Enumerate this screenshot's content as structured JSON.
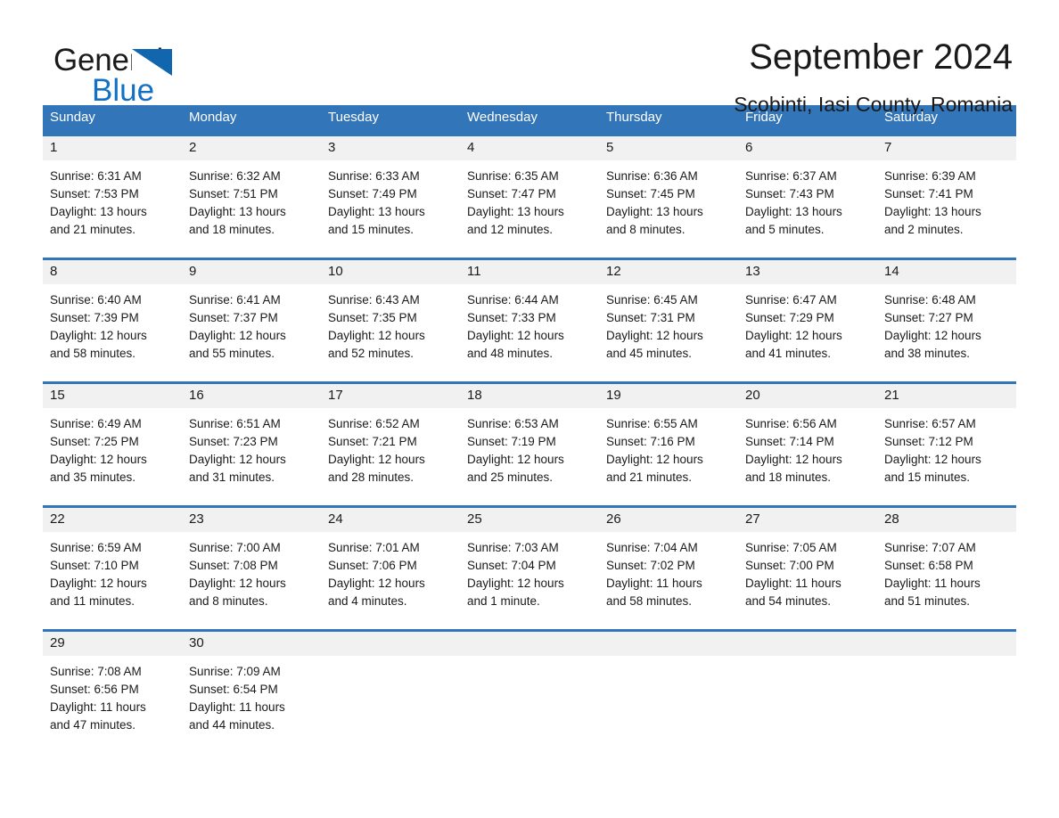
{
  "brand": {
    "name_part1": "General",
    "name_part2": "Blue",
    "triangle_icon": "triangle-icon",
    "accent_color": "#1271c4"
  },
  "header": {
    "title": "September 2024",
    "subtitle": "Scobinti, Iasi County, Romania"
  },
  "colors": {
    "header_blue": "#3275b8",
    "band_gray": "#f1f1f1",
    "text": "#1a1a1a"
  },
  "calendar": {
    "weekday_headers": [
      "Sunday",
      "Monday",
      "Tuesday",
      "Wednesday",
      "Thursday",
      "Friday",
      "Saturday"
    ],
    "weeks": [
      [
        {
          "day": "1",
          "sunrise": "Sunrise: 6:31 AM",
          "sunset": "Sunset: 7:53 PM",
          "daylight1": "Daylight: 13 hours",
          "daylight2": "and 21 minutes."
        },
        {
          "day": "2",
          "sunrise": "Sunrise: 6:32 AM",
          "sunset": "Sunset: 7:51 PM",
          "daylight1": "Daylight: 13 hours",
          "daylight2": "and 18 minutes."
        },
        {
          "day": "3",
          "sunrise": "Sunrise: 6:33 AM",
          "sunset": "Sunset: 7:49 PM",
          "daylight1": "Daylight: 13 hours",
          "daylight2": "and 15 minutes."
        },
        {
          "day": "4",
          "sunrise": "Sunrise: 6:35 AM",
          "sunset": "Sunset: 7:47 PM",
          "daylight1": "Daylight: 13 hours",
          "daylight2": "and 12 minutes."
        },
        {
          "day": "5",
          "sunrise": "Sunrise: 6:36 AM",
          "sunset": "Sunset: 7:45 PM",
          "daylight1": "Daylight: 13 hours",
          "daylight2": "and 8 minutes."
        },
        {
          "day": "6",
          "sunrise": "Sunrise: 6:37 AM",
          "sunset": "Sunset: 7:43 PM",
          "daylight1": "Daylight: 13 hours",
          "daylight2": "and 5 minutes."
        },
        {
          "day": "7",
          "sunrise": "Sunrise: 6:39 AM",
          "sunset": "Sunset: 7:41 PM",
          "daylight1": "Daylight: 13 hours",
          "daylight2": "and 2 minutes."
        }
      ],
      [
        {
          "day": "8",
          "sunrise": "Sunrise: 6:40 AM",
          "sunset": "Sunset: 7:39 PM",
          "daylight1": "Daylight: 12 hours",
          "daylight2": "and 58 minutes."
        },
        {
          "day": "9",
          "sunrise": "Sunrise: 6:41 AM",
          "sunset": "Sunset: 7:37 PM",
          "daylight1": "Daylight: 12 hours",
          "daylight2": "and 55 minutes."
        },
        {
          "day": "10",
          "sunrise": "Sunrise: 6:43 AM",
          "sunset": "Sunset: 7:35 PM",
          "daylight1": "Daylight: 12 hours",
          "daylight2": "and 52 minutes."
        },
        {
          "day": "11",
          "sunrise": "Sunrise: 6:44 AM",
          "sunset": "Sunset: 7:33 PM",
          "daylight1": "Daylight: 12 hours",
          "daylight2": "and 48 minutes."
        },
        {
          "day": "12",
          "sunrise": "Sunrise: 6:45 AM",
          "sunset": "Sunset: 7:31 PM",
          "daylight1": "Daylight: 12 hours",
          "daylight2": "and 45 minutes."
        },
        {
          "day": "13",
          "sunrise": "Sunrise: 6:47 AM",
          "sunset": "Sunset: 7:29 PM",
          "daylight1": "Daylight: 12 hours",
          "daylight2": "and 41 minutes."
        },
        {
          "day": "14",
          "sunrise": "Sunrise: 6:48 AM",
          "sunset": "Sunset: 7:27 PM",
          "daylight1": "Daylight: 12 hours",
          "daylight2": "and 38 minutes."
        }
      ],
      [
        {
          "day": "15",
          "sunrise": "Sunrise: 6:49 AM",
          "sunset": "Sunset: 7:25 PM",
          "daylight1": "Daylight: 12 hours",
          "daylight2": "and 35 minutes."
        },
        {
          "day": "16",
          "sunrise": "Sunrise: 6:51 AM",
          "sunset": "Sunset: 7:23 PM",
          "daylight1": "Daylight: 12 hours",
          "daylight2": "and 31 minutes."
        },
        {
          "day": "17",
          "sunrise": "Sunrise: 6:52 AM",
          "sunset": "Sunset: 7:21 PM",
          "daylight1": "Daylight: 12 hours",
          "daylight2": "and 28 minutes."
        },
        {
          "day": "18",
          "sunrise": "Sunrise: 6:53 AM",
          "sunset": "Sunset: 7:19 PM",
          "daylight1": "Daylight: 12 hours",
          "daylight2": "and 25 minutes."
        },
        {
          "day": "19",
          "sunrise": "Sunrise: 6:55 AM",
          "sunset": "Sunset: 7:16 PM",
          "daylight1": "Daylight: 12 hours",
          "daylight2": "and 21 minutes."
        },
        {
          "day": "20",
          "sunrise": "Sunrise: 6:56 AM",
          "sunset": "Sunset: 7:14 PM",
          "daylight1": "Daylight: 12 hours",
          "daylight2": "and 18 minutes."
        },
        {
          "day": "21",
          "sunrise": "Sunrise: 6:57 AM",
          "sunset": "Sunset: 7:12 PM",
          "daylight1": "Daylight: 12 hours",
          "daylight2": "and 15 minutes."
        }
      ],
      [
        {
          "day": "22",
          "sunrise": "Sunrise: 6:59 AM",
          "sunset": "Sunset: 7:10 PM",
          "daylight1": "Daylight: 12 hours",
          "daylight2": "and 11 minutes."
        },
        {
          "day": "23",
          "sunrise": "Sunrise: 7:00 AM",
          "sunset": "Sunset: 7:08 PM",
          "daylight1": "Daylight: 12 hours",
          "daylight2": "and 8 minutes."
        },
        {
          "day": "24",
          "sunrise": "Sunrise: 7:01 AM",
          "sunset": "Sunset: 7:06 PM",
          "daylight1": "Daylight: 12 hours",
          "daylight2": "and 4 minutes."
        },
        {
          "day": "25",
          "sunrise": "Sunrise: 7:03 AM",
          "sunset": "Sunset: 7:04 PM",
          "daylight1": "Daylight: 12 hours",
          "daylight2": "and 1 minute."
        },
        {
          "day": "26",
          "sunrise": "Sunrise: 7:04 AM",
          "sunset": "Sunset: 7:02 PM",
          "daylight1": "Daylight: 11 hours",
          "daylight2": "and 58 minutes."
        },
        {
          "day": "27",
          "sunrise": "Sunrise: 7:05 AM",
          "sunset": "Sunset: 7:00 PM",
          "daylight1": "Daylight: 11 hours",
          "daylight2": "and 54 minutes."
        },
        {
          "day": "28",
          "sunrise": "Sunrise: 7:07 AM",
          "sunset": "Sunset: 6:58 PM",
          "daylight1": "Daylight: 11 hours",
          "daylight2": "and 51 minutes."
        }
      ],
      [
        {
          "day": "29",
          "sunrise": "Sunrise: 7:08 AM",
          "sunset": "Sunset: 6:56 PM",
          "daylight1": "Daylight: 11 hours",
          "daylight2": "and 47 minutes."
        },
        {
          "day": "30",
          "sunrise": "Sunrise: 7:09 AM",
          "sunset": "Sunset: 6:54 PM",
          "daylight1": "Daylight: 11 hours",
          "daylight2": "and 44 minutes."
        },
        {
          "day": "",
          "sunrise": "",
          "sunset": "",
          "daylight1": "",
          "daylight2": ""
        },
        {
          "day": "",
          "sunrise": "",
          "sunset": "",
          "daylight1": "",
          "daylight2": ""
        },
        {
          "day": "",
          "sunrise": "",
          "sunset": "",
          "daylight1": "",
          "daylight2": ""
        },
        {
          "day": "",
          "sunrise": "",
          "sunset": "",
          "daylight1": "",
          "daylight2": ""
        },
        {
          "day": "",
          "sunrise": "",
          "sunset": "",
          "daylight1": "",
          "daylight2": ""
        }
      ]
    ]
  }
}
